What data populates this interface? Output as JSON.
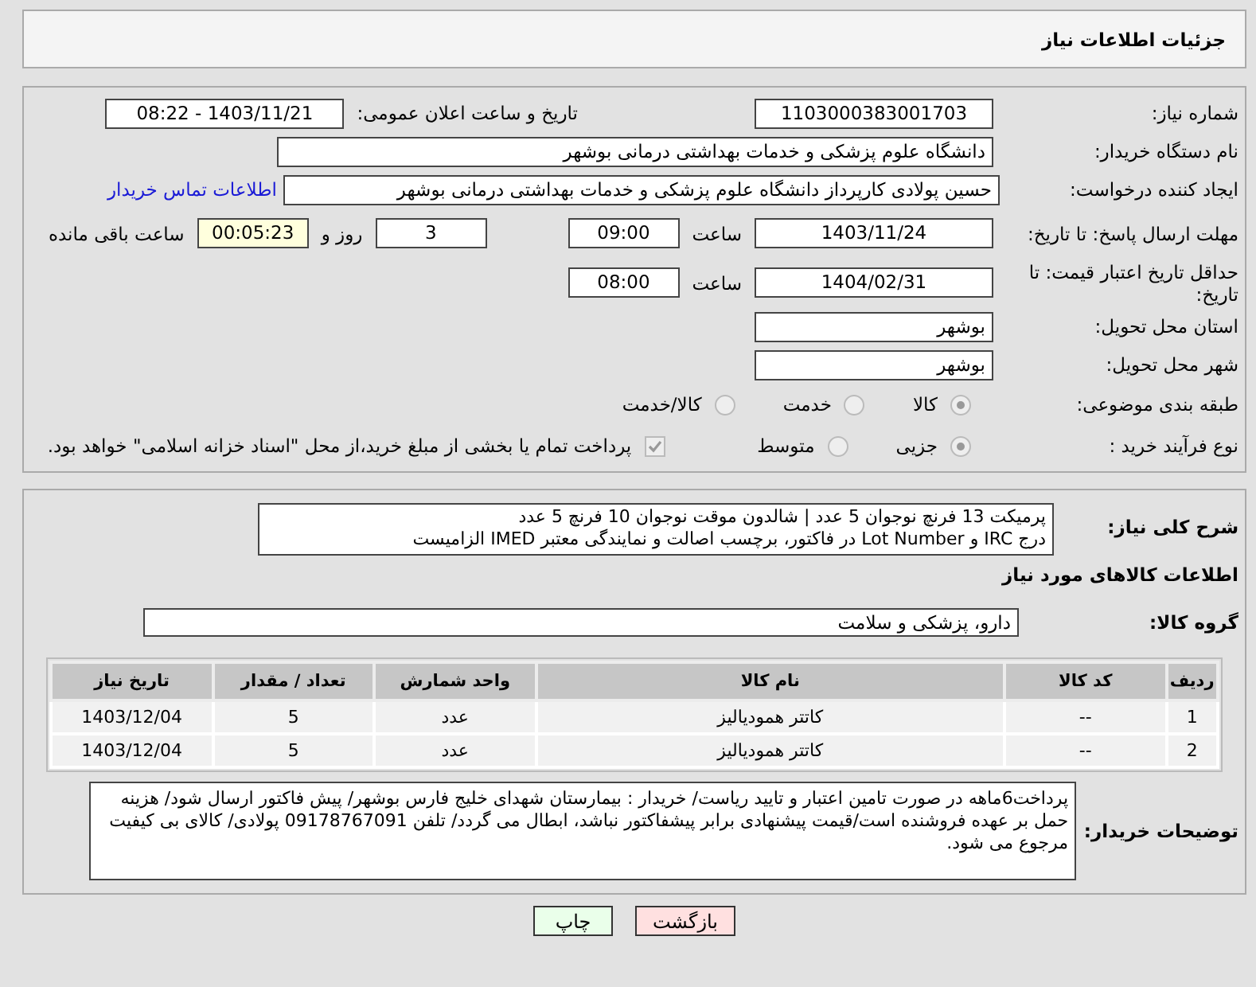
{
  "header": {
    "title": "جزئیات اطلاعات نیاز"
  },
  "need_number": {
    "label": "شماره نیاز:",
    "value": "1103000383001703"
  },
  "announce": {
    "label": "تاریخ و ساعت اعلان عمومی:",
    "value": "1403/11/21 - 08:22"
  },
  "buyer_org": {
    "label": "نام دستگاه خریدار:",
    "value": "دانشگاه علوم پزشکی و خدمات بهداشتی درمانی بوشهر"
  },
  "requester": {
    "label": "ایجاد کننده درخواست:",
    "value": "حسین پولادی کارپرداز دانشگاه علوم پزشکی و خدمات بهداشتی درمانی بوشهر",
    "link": "اطلاعات تماس خریدار"
  },
  "reply_deadline": {
    "label": "مهلت ارسال پاسخ: تا تاریخ:",
    "date": "1403/11/24",
    "time_label": "ساعت",
    "time": "09:00",
    "days": "3",
    "days_label": "روز و",
    "remaining": "00:05:23",
    "remaining_label": "ساعت باقی مانده"
  },
  "price_validity": {
    "label": "حداقل تاریخ اعتبار قیمت: تا تاریخ:",
    "date": "1404/02/31",
    "time_label": "ساعت",
    "time": "08:00"
  },
  "province": {
    "label": "استان محل تحویل:",
    "value": "بوشهر"
  },
  "city": {
    "label": "شهر محل تحویل:",
    "value": "بوشهر"
  },
  "category": {
    "label": "طبقه بندی موضوعی:",
    "options": [
      {
        "label": "کالا",
        "selected": true
      },
      {
        "label": "خدمت",
        "selected": false
      },
      {
        "label": "کالا/خدمت",
        "selected": false
      }
    ]
  },
  "process": {
    "label": "نوع فرآیند خرید :",
    "options": [
      {
        "label": "جزیی",
        "selected": true
      },
      {
        "label": "متوسط",
        "selected": false
      }
    ],
    "payment": {
      "label": "پرداخت تمام یا بخشی از مبلغ خرید،از محل \"اسناد خزانه اسلامی\" خواهد بود.",
      "checked": true
    }
  },
  "description": {
    "label": "شرح کلی نیاز:",
    "lines": [
      "پرمیکت 13 فرنچ نوجوان 5 عدد | شالدون موقت نوجوان 10 فرنچ 5 عدد",
      "درج IRC و Lot Number در فاکتور، برچسب اصالت و نمایندگی معتبر IMED الزامیست"
    ]
  },
  "items_heading": "اطلاعات کالاهای مورد نیاز",
  "goods_group": {
    "label": "گروه کالا:",
    "value": "دارو، پزشکی و سلامت"
  },
  "table": {
    "columns": [
      "ردیف",
      "کد کالا",
      "نام کالا",
      "واحد شمارش",
      "تعداد / مقدار",
      "تاریخ نیاز"
    ],
    "rows": [
      [
        "1",
        "--",
        "کاتتر همودیالیز",
        "عدد",
        "5",
        "1403/12/04"
      ],
      [
        "2",
        "--",
        "کاتتر همودیالیز",
        "عدد",
        "5",
        "1403/12/04"
      ]
    ]
  },
  "buyer_notes": {
    "label": "توضیحات خریدار:",
    "text": "پرداخت6ماهه در صورت تامین اعتبار و تایید ریاست/ خریدار : بیمارستان شهدای خلیج فارس بوشهر/ پیش فاکتور ارسال شود/ هزینه حمل بر عهده فروشنده است/قیمت پیشنهادی برابر پیشفاکتور نباشد، ابطال می گردد/ تلفن 09178767091 پولادی/ کالای بی کیفیت مرجوع می شود."
  },
  "buttons": [
    {
      "label": "بازگشت",
      "kind": "back"
    },
    {
      "label": "چاپ",
      "kind": "print"
    }
  ]
}
